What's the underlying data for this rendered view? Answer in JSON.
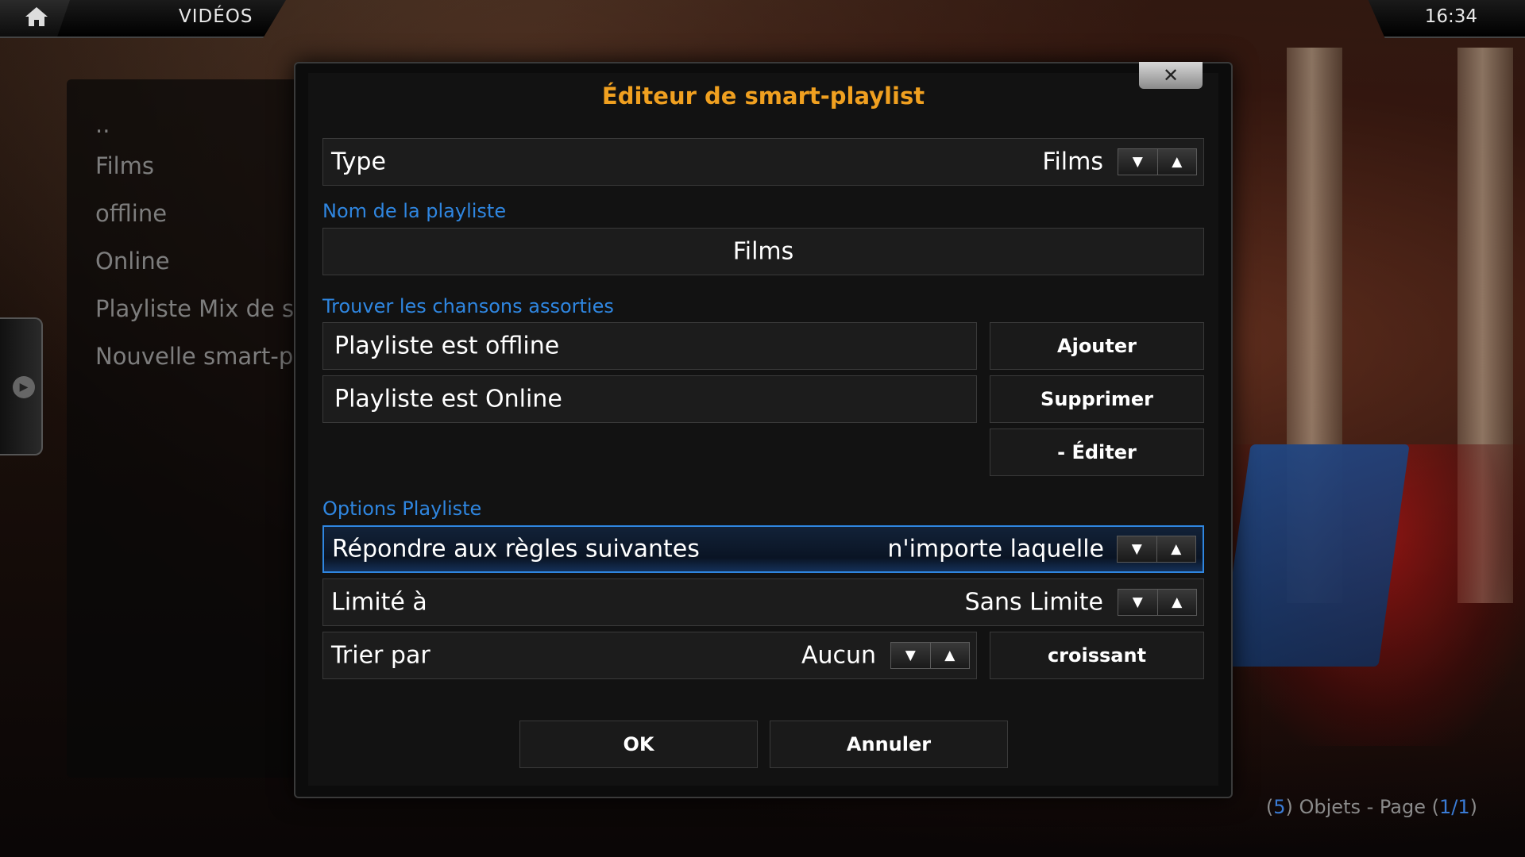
{
  "header": {
    "section_title": "VIDÉOS",
    "clock": "16:34"
  },
  "list": {
    "items": [
      "..",
      "Films",
      "offline",
      "Online",
      "Playliste Mix de s",
      "Nouvelle smart-p"
    ]
  },
  "footer": {
    "open": "(",
    "count": "5",
    "mid": ") Objets - Page (",
    "page": "1/1",
    "close": ")"
  },
  "dialog": {
    "title": "Éditeur de smart-playlist",
    "close_label": "✕",
    "type": {
      "label": "Type",
      "value": "Films"
    },
    "name_section": "Nom de la playliste",
    "name_value": "Films",
    "rules_section": "Trouver les chansons assorties",
    "rules": [
      "Playliste est offline",
      "Playliste est Online"
    ],
    "rule_buttons": {
      "add": "Ajouter",
      "remove": "Supprimer",
      "edit": "- Éditer"
    },
    "options_section": "Options Playliste",
    "match": {
      "label": "Répondre aux règles suivantes",
      "value": "n'importe laquelle"
    },
    "limit": {
      "label": "Limité à",
      "value": "Sans Limite"
    },
    "order": {
      "label": "Trier par",
      "value": "Aucun",
      "direction": "croissant"
    },
    "ok_label": "OK",
    "cancel_label": "Annuler"
  },
  "icons": {
    "home": "home-icon",
    "down": "▼",
    "up": "▲"
  },
  "colors": {
    "title": "#f0a020",
    "section": "#2f86e0",
    "focus": "#2f86e0"
  }
}
